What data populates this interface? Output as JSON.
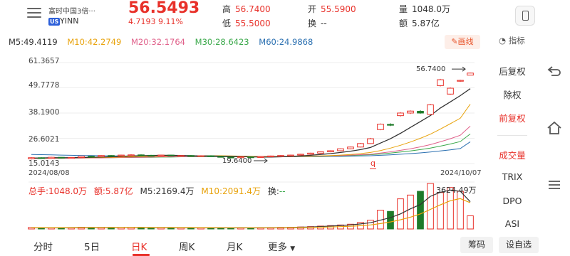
{
  "header": {
    "stock_name": "富时中国3倍···",
    "market": "US",
    "ticker": "YINN",
    "price": "56.5493",
    "change": "4.7193  9.11%",
    "quote": [
      {
        "label": "高",
        "value": "56.7400",
        "tone": "red"
      },
      {
        "label": "低",
        "value": "55.5000",
        "tone": "red"
      },
      {
        "label": "开",
        "value": "55.5900",
        "tone": "red"
      },
      {
        "label": "换",
        "value": "--",
        "tone": "plain"
      },
      {
        "label": "量",
        "value": "1048.0万",
        "tone": "plain"
      },
      {
        "label": "额",
        "value": "5.87亿",
        "tone": "plain"
      }
    ]
  },
  "ma": [
    {
      "label": "M5:49.4119",
      "color": "#333333"
    },
    {
      "label": "M10:42.2749",
      "color": "#e8a20a"
    },
    {
      "label": "M20:32.1764",
      "color": "#e0608a"
    },
    {
      "label": "M30:28.6423",
      "color": "#3aa84a"
    },
    {
      "label": "M60:24.9868",
      "color": "#2a6fb0"
    }
  ],
  "toolbar": {
    "draw_label": "画线",
    "indicator_label": "指标"
  },
  "side_panel": [
    {
      "label": "后复权",
      "active": false
    },
    {
      "label": "除权",
      "active": false
    },
    {
      "label": "前复权",
      "active": true
    },
    {
      "label": "成交量",
      "active": true
    },
    {
      "label": "TRIX",
      "active": false
    },
    {
      "label": "DPO",
      "active": false
    },
    {
      "label": "ASI",
      "active": false
    }
  ],
  "chart_data": {
    "type": "candlestick",
    "y_labels": [
      "61.3657",
      "49.7778",
      "38.1900",
      "26.6021",
      "15.0143"
    ],
    "ylim": [
      15.0143,
      61.3657
    ],
    "x_start": "2024/08/08",
    "x_end": "2024/10/07",
    "annotations": {
      "high": "56.7400",
      "low": "19.6400",
      "low_marker": "q"
    },
    "up_color": "#e8312a",
    "down_color": "#1f7a2a",
    "candles": [
      [
        17.2,
        17.7,
        16.9,
        17.9
      ],
      [
        17.7,
        17.4,
        17.2,
        17.9
      ],
      [
        17.4,
        17.9,
        17.3,
        18.1
      ],
      [
        17.9,
        17.6,
        17.4,
        18.0
      ],
      [
        17.6,
        17.8,
        17.4,
        18.0
      ],
      [
        17.8,
        18.4,
        17.6,
        18.6
      ],
      [
        18.4,
        18.2,
        18.0,
        18.6
      ],
      [
        18.2,
        18.7,
        18.0,
        18.9
      ],
      [
        18.7,
        18.5,
        18.3,
        18.9
      ],
      [
        18.5,
        18.9,
        18.3,
        19.1
      ],
      [
        18.9,
        19.0,
        18.7,
        19.3
      ],
      [
        19.0,
        18.8,
        18.6,
        19.2
      ],
      [
        18.8,
        18.6,
        18.4,
        19.0
      ],
      [
        18.6,
        18.9,
        18.4,
        19.1
      ],
      [
        18.9,
        18.5,
        18.3,
        19.1
      ],
      [
        18.5,
        18.7,
        18.3,
        18.9
      ],
      [
        18.7,
        18.4,
        18.2,
        18.9
      ],
      [
        18.4,
        18.6,
        18.2,
        18.8
      ],
      [
        18.6,
        18.3,
        18.1,
        18.8
      ],
      [
        18.3,
        18.0,
        17.8,
        18.5
      ],
      [
        18.0,
        17.8,
        17.6,
        18.2
      ],
      [
        17.8,
        18.1,
        17.6,
        18.3
      ],
      [
        18.1,
        17.9,
        17.7,
        18.3
      ],
      [
        17.9,
        18.2,
        17.7,
        18.4
      ],
      [
        18.2,
        18.5,
        18.0,
        18.7
      ],
      [
        18.5,
        18.7,
        18.3,
        18.9
      ],
      [
        18.7,
        18.9,
        18.5,
        19.1
      ],
      [
        18.9,
        19.3,
        18.7,
        19.5
      ],
      [
        19.3,
        19.8,
        19.1,
        20.0
      ],
      [
        19.8,
        20.4,
        19.6,
        20.6
      ],
      [
        20.4,
        20.9,
        20.2,
        21.1
      ],
      [
        20.9,
        21.8,
        20.7,
        22.0
      ],
      [
        21.8,
        22.6,
        21.6,
        22.8
      ],
      [
        22.6,
        24.2,
        22.4,
        24.5
      ],
      [
        24.2,
        26.4,
        24.0,
        26.8
      ],
      [
        30.6,
        33.1,
        30.3,
        33.4
      ],
      [
        33.0,
        32.6,
        32.2,
        33.5
      ],
      [
        37.0,
        38.2,
        36.6,
        38.6
      ],
      [
        38.2,
        39.1,
        37.8,
        39.4
      ],
      [
        39.0,
        38.2,
        37.9,
        39.5
      ],
      [
        37.6,
        42.0,
        37.3,
        42.4
      ],
      [
        50.8,
        53.5,
        50.4,
        53.9
      ],
      [
        46.9,
        49.6,
        46.6,
        50.0
      ],
      [
        53.0,
        53.2,
        52.6,
        53.5
      ],
      [
        55.6,
        56.55,
        55.5,
        56.74
      ]
    ],
    "ma_series": [
      {
        "name": "M5",
        "color": "#333333",
        "values": [
          17.5,
          17.6,
          17.7,
          17.7,
          17.7,
          17.8,
          17.9,
          18.0,
          18.1,
          18.3,
          18.5,
          18.6,
          18.7,
          18.8,
          18.8,
          18.7,
          18.6,
          18.5,
          18.5,
          18.4,
          18.3,
          18.2,
          18.1,
          18.0,
          18.0,
          18.1,
          18.3,
          18.5,
          18.8,
          19.2,
          19.6,
          20.1,
          20.7,
          21.4,
          22.4,
          24.4,
          26.4,
          28.9,
          31.6,
          34.3,
          37.0,
          40.5,
          43.3,
          46.2,
          49.4
        ]
      },
      {
        "name": "M10",
        "color": "#e8a20a",
        "values": [
          17.4,
          17.5,
          17.5,
          17.6,
          17.6,
          17.7,
          17.7,
          17.8,
          17.9,
          18.0,
          18.1,
          18.2,
          18.3,
          18.4,
          18.5,
          18.6,
          18.6,
          18.6,
          18.6,
          18.6,
          18.5,
          18.4,
          18.3,
          18.2,
          18.2,
          18.2,
          18.2,
          18.3,
          18.4,
          18.5,
          18.7,
          18.9,
          19.2,
          19.6,
          20.1,
          21.0,
          22.1,
          23.4,
          24.9,
          26.6,
          28.5,
          30.8,
          33.3,
          35.8,
          42.3
        ]
      },
      {
        "name": "M20",
        "color": "#e0608a",
        "values": [
          17.3,
          17.3,
          17.4,
          17.4,
          17.5,
          17.5,
          17.6,
          17.6,
          17.7,
          17.8,
          17.9,
          17.9,
          18.0,
          18.1,
          18.1,
          18.2,
          18.2,
          18.3,
          18.3,
          18.3,
          18.3,
          18.3,
          18.3,
          18.3,
          18.3,
          18.3,
          18.3,
          18.4,
          18.4,
          18.5,
          18.6,
          18.7,
          18.9,
          19.1,
          19.3,
          19.8,
          20.4,
          21.1,
          21.8,
          22.7,
          23.7,
          25.0,
          26.4,
          28.0,
          32.2
        ]
      },
      {
        "name": "M30",
        "color": "#3aa84a",
        "values": [
          17.6,
          17.6,
          17.6,
          17.6,
          17.6,
          17.7,
          17.7,
          17.7,
          17.7,
          17.8,
          17.8,
          17.9,
          17.9,
          18.0,
          18.0,
          18.1,
          18.1,
          18.1,
          18.2,
          18.2,
          18.2,
          18.2,
          18.2,
          18.2,
          18.3,
          18.3,
          18.3,
          18.3,
          18.4,
          18.4,
          18.5,
          18.6,
          18.7,
          18.9,
          19.1,
          19.4,
          19.8,
          20.3,
          20.8,
          21.4,
          22.1,
          23.0,
          24.0,
          25.1,
          28.6
        ]
      },
      {
        "name": "M60",
        "color": "#2a6fb0",
        "values": [
          19.2,
          19.1,
          19.0,
          18.9,
          18.8,
          18.7,
          18.7,
          18.6,
          18.5,
          18.5,
          18.4,
          18.4,
          18.3,
          18.3,
          18.3,
          18.2,
          18.2,
          18.2,
          18.2,
          18.2,
          18.1,
          18.1,
          18.1,
          18.1,
          18.1,
          18.1,
          18.1,
          18.2,
          18.2,
          18.2,
          18.3,
          18.3,
          18.4,
          18.5,
          18.6,
          18.8,
          19.0,
          19.3,
          19.6,
          19.9,
          20.3,
          20.8,
          21.3,
          21.9,
          25.0
        ]
      }
    ],
    "volume": {
      "info": [
        {
          "label": "总手:1048.0万",
          "color": "#e8312a"
        },
        {
          "label": "额:5.87亿",
          "color": "#e8312a"
        },
        {
          "label": "M5:2169.4万",
          "color": "#333333"
        },
        {
          "label": "M10:2091.4万",
          "color": "#e8a20a"
        },
        {
          "label": "换:",
          "color": "#333333"
        },
        {
          "label": "--",
          "color": "#3aa84a"
        }
      ],
      "max_label": "3624.49万",
      "values": [
        120,
        90,
        110,
        95,
        100,
        140,
        105,
        130,
        110,
        125,
        135,
        115,
        100,
        120,
        110,
        105,
        95,
        100,
        90,
        85,
        80,
        95,
        85,
        100,
        115,
        130,
        140,
        160,
        190,
        230,
        270,
        320,
        380,
        520,
        700,
        1500,
        1400,
        2400,
        2700,
        3000,
        3624,
        2900,
        3300,
        3000,
        1048
      ],
      "up": [
        1,
        0,
        1,
        0,
        1,
        1,
        0,
        1,
        0,
        1,
        1,
        0,
        0,
        1,
        0,
        1,
        0,
        1,
        0,
        0,
        0,
        1,
        0,
        1,
        1,
        1,
        1,
        1,
        1,
        1,
        1,
        1,
        1,
        1,
        1,
        1,
        0,
        1,
        1,
        0,
        1,
        1,
        1,
        1,
        1
      ],
      "ma5": [
        110,
        110,
        108,
        110,
        112,
        120,
        118,
        120,
        122,
        125,
        120,
        118,
        116,
        115,
        112,
        110,
        106,
        104,
        98,
        92,
        90,
        92,
        92,
        95,
        100,
        110,
        120,
        140,
        160,
        190,
        230,
        280,
        330,
        400,
        500,
        700,
        900,
        1200,
        1600,
        1950,
        2600,
        2920,
        3100,
        3000,
        2169
      ],
      "ma10": [
        105,
        105,
        106,
        107,
        108,
        110,
        112,
        114,
        115,
        118,
        118,
        117,
        116,
        116,
        115,
        114,
        112,
        110,
        106,
        102,
        99,
        98,
        97,
        97,
        98,
        102,
        108,
        116,
        127,
        142,
        160,
        185,
        215,
        260,
        320,
        430,
        560,
        730,
        940,
        1200,
        1560,
        1920,
        2250,
        2420,
        2091
      ]
    }
  },
  "tabs": [
    {
      "label": "分时",
      "active": false
    },
    {
      "label": "5日",
      "active": false
    },
    {
      "label": "日K",
      "active": true
    },
    {
      "label": "周K",
      "active": false
    },
    {
      "label": "月K",
      "active": false
    },
    {
      "label": "更多",
      "active": false
    }
  ],
  "bottom_buttons": {
    "chips": "筹码",
    "settings": "设自选"
  }
}
